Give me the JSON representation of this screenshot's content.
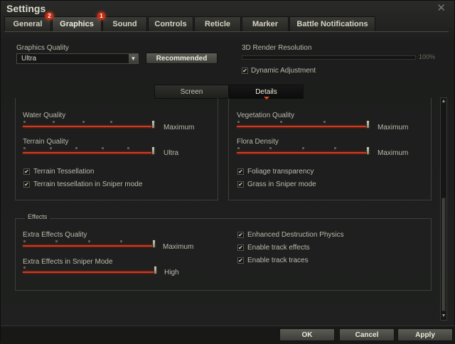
{
  "window": {
    "title": "Settings",
    "close_glyph": "✕"
  },
  "tabs": [
    {
      "label": "General"
    },
    {
      "label": "Graphics",
      "badge": "2"
    },
    {
      "label": "Sound",
      "badge": "1"
    },
    {
      "label": "Controls"
    },
    {
      "label": "Reticle"
    },
    {
      "label": "Marker"
    },
    {
      "label": "Battle Notifications"
    }
  ],
  "graphics_quality": {
    "label": "Graphics Quality",
    "value": "Ultra",
    "recommended_label": "Recommended"
  },
  "render_resolution": {
    "label": "3D Render Resolution",
    "value": "100%",
    "level": 1.0
  },
  "dynamic_adjustment": {
    "label": "Dynamic Adjustment",
    "checked": true
  },
  "subtabs": [
    {
      "label": "Screen"
    },
    {
      "label": "Details"
    }
  ],
  "details": {
    "left": {
      "water_quality": {
        "label": "Water Quality",
        "value": "Maximum",
        "level": 1.0
      },
      "terrain_quality": {
        "label": "Terrain Quality",
        "value": "Ultra",
        "level": 1.0
      },
      "terrain_tessellation": {
        "label": "Terrain Tessellation",
        "checked": true
      },
      "terrain_tessellation_sniper": {
        "label": "Terrain tessellation in Sniper mode",
        "checked": true
      }
    },
    "right": {
      "vegetation_quality": {
        "label": "Vegetation Quality",
        "value": "Maximum",
        "level": 1.0
      },
      "flora_density": {
        "label": "Flora Density",
        "value": "Maximum",
        "level": 1.0
      },
      "foliage_transparency": {
        "label": "Foliage transparency",
        "checked": true
      },
      "grass_sniper": {
        "label": "Grass in Sniper mode",
        "checked": true
      }
    }
  },
  "effects": {
    "title": "Effects",
    "extra_effects_quality": {
      "label": "Extra Effects Quality",
      "value": "Maximum",
      "level": 1.0
    },
    "extra_effects_sniper": {
      "label": "Extra Effects in Sniper Mode",
      "value": "High",
      "level": 1.0
    },
    "enhanced_destruction": {
      "label": "Enhanced Destruction Physics",
      "checked": true
    },
    "track_effects": {
      "label": "Enable track effects",
      "checked": true
    },
    "track_traces": {
      "label": "Enable track traces",
      "checked": true
    }
  },
  "buttons": {
    "ok": "OK",
    "cancel": "Cancel",
    "apply": "Apply"
  },
  "glyphs": {
    "check": "✔",
    "dropdown": "▼",
    "scroll_up": "▲",
    "scroll_down": "▼"
  },
  "colors": {
    "accent": "#d33a20",
    "badge": "#c62e15"
  }
}
